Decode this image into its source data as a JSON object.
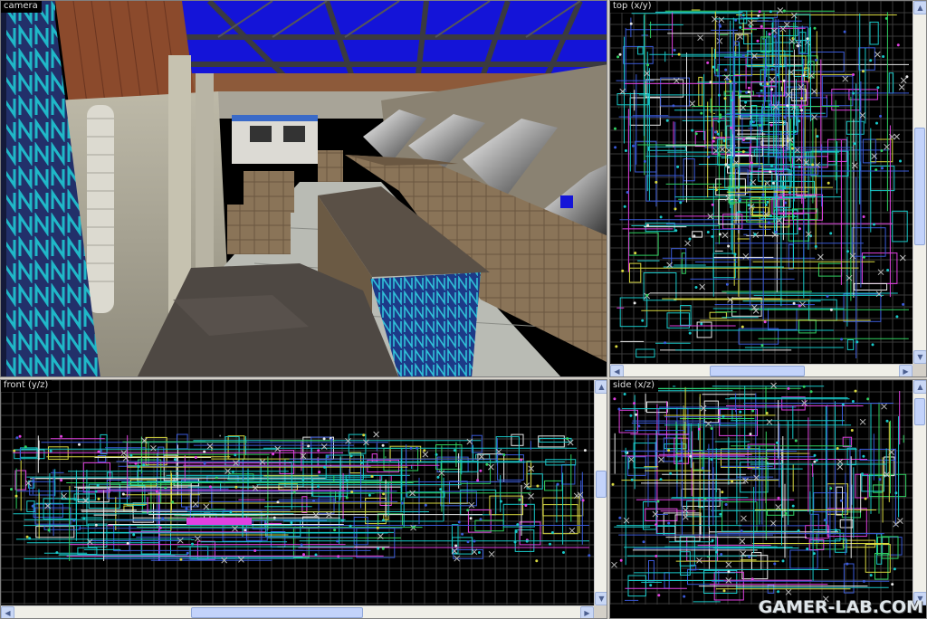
{
  "viewports": {
    "camera": {
      "label": "camera"
    },
    "top": {
      "label": "top (x/y)"
    },
    "front": {
      "label": "front (y/z)"
    },
    "side": {
      "label": "side (x/z)"
    }
  },
  "watermark": {
    "text": "GAMER-LAB.COM"
  },
  "colors": {
    "grid": "#3a3a3a",
    "brush_cyan": "#18c8c8",
    "brush_magenta": "#e040e0",
    "brush_green": "#30d060",
    "brush_blue": "#3a5ad8",
    "brush_white": "#e8e8e8",
    "brush_yellow": "#d8d840",
    "brush_red": "#d84040",
    "sky": "#1010e0"
  },
  "icons": {
    "scroll_up": "arrow-up-icon",
    "scroll_down": "arrow-down-icon",
    "scroll_left": "arrow-left-icon",
    "scroll_right": "arrow-right-icon"
  }
}
